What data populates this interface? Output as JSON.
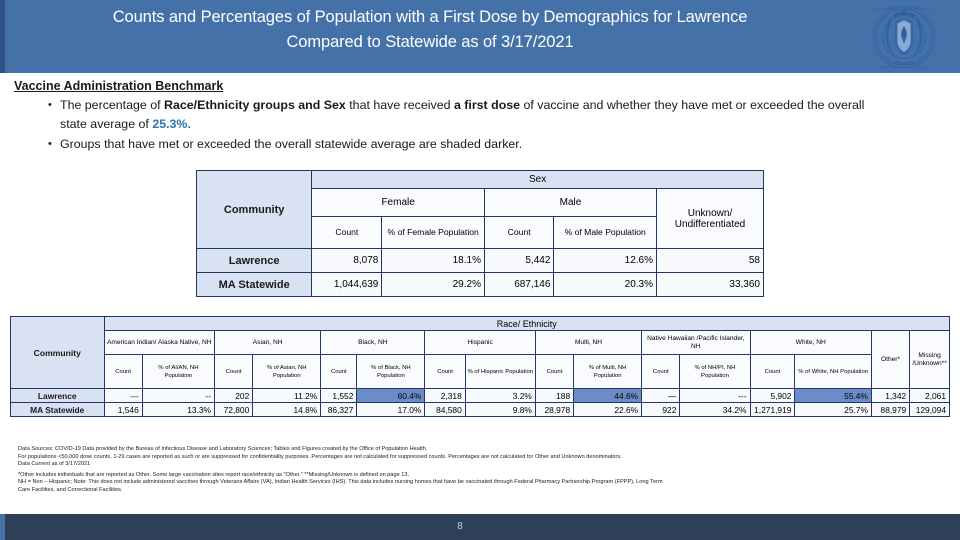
{
  "header": {
    "title_line1": "Counts and Percentages of Population with a First Dose by Demographics for Lawrence",
    "title_line2": "Compared to Statewide as of 3/17/2021",
    "seal_name": "massachusetts-state-seal",
    "banner_color": "#4472A8"
  },
  "benchmark": {
    "heading": "Vaccine Administration Benchmark",
    "bullet_glyph": "•",
    "bullet1_a": "The percentage of ",
    "bullet1_b": "Race/Ethnicity groups and Sex",
    "bullet1_c": " that have received ",
    "bullet1_d": "a first dose",
    "bullet1_e": " of vaccine and whether they have met or exceeded the overall state average of ",
    "bullet1_value": "25.3%.",
    "bullet2": "Groups that have met or exceeded the overall statewide average are shaded darker.",
    "accent_color": "#2E75B6"
  },
  "sex_table": {
    "community_label": "Community",
    "group_label": "Sex",
    "groups": [
      "Female",
      "Male",
      "Unknown/ Undifferentiated"
    ],
    "subheaders": [
      "Count",
      "% of Female Population",
      "Count",
      "% of Male Population",
      "Count"
    ],
    "rows": [
      {
        "label": "Lawrence",
        "values": [
          "8,078",
          "18.1%",
          "5,442",
          "12.6%",
          "58"
        ],
        "shaded": [
          false,
          false,
          false,
          false,
          false
        ]
      },
      {
        "label": "MA Statewide",
        "values": [
          "1,044,639",
          "29.2%",
          "687,146",
          "20.3%",
          "33,360"
        ],
        "shaded": [
          false,
          false,
          false,
          false,
          false
        ]
      }
    ]
  },
  "race_table": {
    "community_label": "Community",
    "group_label": "Race/ Ethnicity",
    "groups": [
      "American Indian/ Alaska Native, NH",
      "Asian, NH",
      "Black, NH",
      "Hispanic",
      "Multi, NH",
      "Native Hawaiian /Pacific Islander, NH",
      "White, NH",
      "Other*",
      "Missing /Unknown**"
    ],
    "subheaders": [
      "Count",
      "% of AI/AN, NH Population",
      "Count",
      "% of Asian, NH Population",
      "Count",
      "% of Black, NH Population",
      "Count",
      "% of Hispanic Population",
      "Count",
      "% of Multi, NH Population",
      "Count",
      "% of NH/PI, NH Population",
      "Count",
      "% of White, NH Population",
      "Count",
      "Count"
    ],
    "rows": [
      {
        "label": "Lawrence",
        "values": [
          "---",
          "--",
          "202",
          "11.2%",
          "1,552",
          "60.4%",
          "2,318",
          "3.2%",
          "188",
          "44.6%",
          "—",
          "---",
          "5,902",
          "55.4%",
          "1,342",
          "2,061"
        ],
        "shaded": [
          false,
          false,
          false,
          false,
          false,
          true,
          false,
          false,
          false,
          true,
          false,
          false,
          false,
          true,
          false,
          false
        ]
      },
      {
        "label": "MA Statewide",
        "values": [
          "1,546",
          "13.3%",
          "72,800",
          "14.8%",
          "86,327",
          "17.0%",
          "84,580",
          "9.8%",
          "28,978",
          "22.6%",
          "922",
          "34.2%",
          "1,271,919",
          "25.7%",
          "88,979",
          "129,094"
        ],
        "shaded": [
          false,
          false,
          false,
          false,
          false,
          false,
          false,
          false,
          false,
          false,
          false,
          false,
          false,
          false,
          false,
          false
        ]
      }
    ],
    "shade_color": "#6C8CC7"
  },
  "footnotes": {
    "line1": "Data Sources: COVID-19 Data provided by the Bureau of Infectious Disease and Laboratory Sciences; Tables and Figures created by the Office of Population Health.",
    "line2": "For populations <50,000 dose counts, 1-29 cases are reported as such or are suppressed for confidentiality purposes. Percentages are not calculated for suppressed counts. Percentages are not calculated for Other and Unknown denominators.",
    "line3": "Data Current as of 3/17/2021",
    "line4": "*Other includes individuals that are reported as Other. Some large vaccination sites report race/ethnicity as \"Other.\"  **Missing/Unknown is defined on page 13.",
    "line5": "NH = Non – Hispanic; Note: This does not include administered vaccines through Veterans Affairs (VA), Indian Health Services (IHS). This data includes nursing homes that have be vaccinated through Federal Pharmacy Partnership Program (FPPP), Long Term",
    "line6": "Care Facilities, and Correctional Facilities."
  },
  "footer": {
    "page_number": "8",
    "bar_color": "#2E4057"
  }
}
